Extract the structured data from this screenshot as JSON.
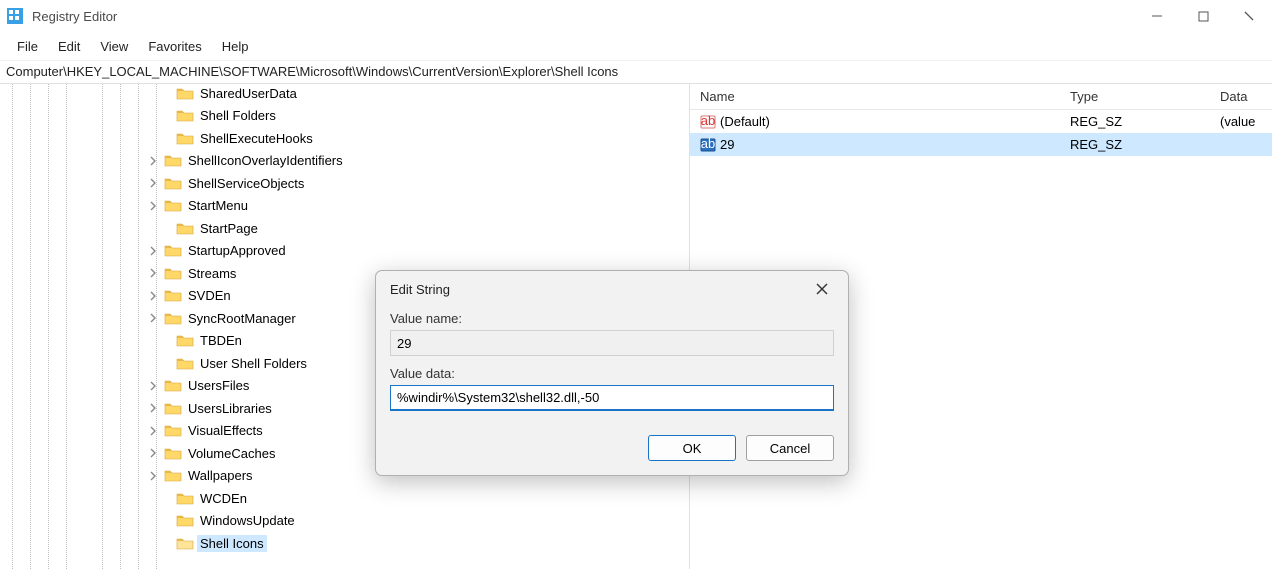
{
  "app": {
    "title": "Registry Editor"
  },
  "menu": {
    "file": "File",
    "edit": "Edit",
    "view": "View",
    "favorites": "Favorites",
    "help": "Help"
  },
  "path": "Computer\\HKEY_LOCAL_MACHINE\\SOFTWARE\\Microsoft\\Windows\\CurrentVersion\\Explorer\\Shell Icons",
  "tree": {
    "nodes": [
      {
        "label": "SharedUserData",
        "chevron": false,
        "indent": 160
      },
      {
        "label": "Shell Folders",
        "chevron": false,
        "indent": 160
      },
      {
        "label": "ShellExecuteHooks",
        "chevron": false,
        "indent": 160
      },
      {
        "label": "ShellIconOverlayIdentifiers",
        "chevron": true,
        "indent": 148
      },
      {
        "label": "ShellServiceObjects",
        "chevron": true,
        "indent": 148
      },
      {
        "label": "StartMenu",
        "chevron": true,
        "indent": 148
      },
      {
        "label": "StartPage",
        "chevron": false,
        "indent": 160
      },
      {
        "label": "StartupApproved",
        "chevron": true,
        "indent": 148
      },
      {
        "label": "Streams",
        "chevron": true,
        "indent": 148
      },
      {
        "label": "SVDEn",
        "chevron": true,
        "indent": 148
      },
      {
        "label": "SyncRootManager",
        "chevron": true,
        "indent": 148
      },
      {
        "label": "TBDEn",
        "chevron": false,
        "indent": 160
      },
      {
        "label": "User Shell Folders",
        "chevron": false,
        "indent": 160
      },
      {
        "label": "UsersFiles",
        "chevron": true,
        "indent": 148
      },
      {
        "label": "UsersLibraries",
        "chevron": true,
        "indent": 148
      },
      {
        "label": "VisualEffects",
        "chevron": true,
        "indent": 148
      },
      {
        "label": "VolumeCaches",
        "chevron": true,
        "indent": 148
      },
      {
        "label": "Wallpapers",
        "chevron": true,
        "indent": 148
      },
      {
        "label": "WCDEn",
        "chevron": false,
        "indent": 160
      },
      {
        "label": "WindowsUpdate",
        "chevron": false,
        "indent": 160
      },
      {
        "label": "Shell Icons",
        "chevron": false,
        "indent": 160,
        "selected": true
      }
    ]
  },
  "list": {
    "headers": {
      "name": "Name",
      "type": "Type",
      "data": "Data"
    },
    "rows": [
      {
        "name": "(Default)",
        "type": "REG_SZ",
        "data": "(value",
        "selected": false
      },
      {
        "name": "29",
        "type": "REG_SZ",
        "data": "",
        "selected": true
      }
    ]
  },
  "dialog": {
    "title": "Edit String",
    "value_name_label": "Value name:",
    "value_name": "29",
    "value_data_label": "Value data:",
    "value_data": "%windir%\\System32\\shell32.dll,-50",
    "ok": "OK",
    "cancel": "Cancel"
  }
}
